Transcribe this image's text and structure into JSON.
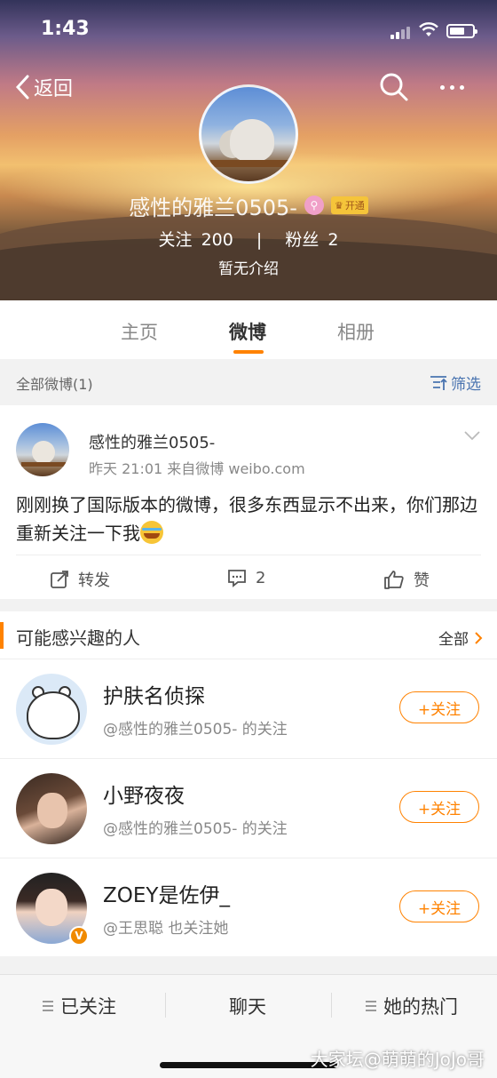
{
  "status_bar": {
    "time": "1:43"
  },
  "nav": {
    "back_label": "返回"
  },
  "profile": {
    "name": "感性的雅兰0505-",
    "vip_label": "开通",
    "following_label": "关注",
    "following_count": "200",
    "separator": "|",
    "followers_label": "粉丝",
    "followers_count": "2",
    "bio": "暂无介绍"
  },
  "tabs": [
    {
      "label": "主页"
    },
    {
      "label": "微博"
    },
    {
      "label": "相册"
    }
  ],
  "filter": {
    "all_label": "全部微博(1)",
    "filter_label": "筛选"
  },
  "post": {
    "author": "感性的雅兰0505-",
    "meta": "昨天 21:01  来自微博 weibo.com",
    "text": "刚刚换了国际版本的微博，很多东西显示不出来，你们那边重新关注一下我",
    "repost_label": "转发",
    "comment_count": "2",
    "like_label": "赞"
  },
  "recommend": {
    "title": "可能感兴趣的人",
    "all_label": "全部",
    "follow_label": "+关注",
    "people": [
      {
        "name": "护肤名侦探",
        "sub": "@感性的雅兰0505- 的关注"
      },
      {
        "name": "小野夜夜",
        "sub": "@感性的雅兰0505- 的关注"
      },
      {
        "name": "ZOEY是佐伊_",
        "sub": "@王思聪 也关注她",
        "badge": "V"
      }
    ]
  },
  "bottom_bar": {
    "followed_label": "已关注",
    "chat_label": "聊天",
    "hot_label": "她的热门"
  },
  "watermark": "大家坛@萌萌的JoJo哥",
  "colors": {
    "accent": "#ff8200",
    "link": "#4a74b0"
  }
}
